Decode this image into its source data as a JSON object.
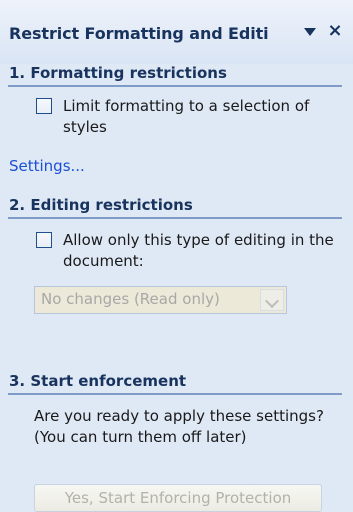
{
  "pane": {
    "title": "Restrict Formatting and Editi",
    "menu_icon": "triangle-down-icon",
    "close_icon": "close-icon",
    "close_glyph": "×"
  },
  "section1": {
    "heading": "1. Formatting restrictions",
    "checkbox_label": "Limit formatting to a selection of styles",
    "checked": false,
    "settings_link": "Settings..."
  },
  "section2": {
    "heading": "2. Editing restrictions",
    "checkbox_label": "Allow only this type of editing in the document:",
    "checked": false,
    "select_value": "No changes (Read only)"
  },
  "section3": {
    "heading": "3. Start enforcement",
    "prompt": "Are you ready to apply these settings? (You can turn them off later)",
    "button_label": "Yes, Start Enforcing Protection"
  },
  "colors": {
    "pane_background": "#dfe8f5",
    "heading": "#17335e",
    "link": "#1a4fd6",
    "disabled_text": "#a8a8a8"
  }
}
